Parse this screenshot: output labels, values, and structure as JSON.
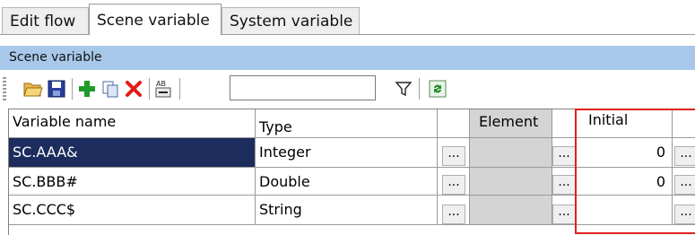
{
  "tabs": [
    {
      "label": "Edit flow"
    },
    {
      "label": "Scene variable"
    },
    {
      "label": "System variable"
    }
  ],
  "panel": {
    "title": "Scene variable"
  },
  "toolbar": {
    "search_value": "",
    "icons": [
      "open-folder-icon",
      "save-icon",
      "add-icon",
      "copy-icon",
      "delete-icon",
      "find-replace-icon",
      "filter-icon",
      "refresh-icon"
    ]
  },
  "grid": {
    "headers": {
      "name": "Variable name",
      "type": "Type",
      "element": "Element",
      "initial": "Initial"
    },
    "rows": [
      {
        "name": "SC.AAA&",
        "type": "Integer",
        "initial": "0"
      },
      {
        "name": "SC.BBB#",
        "type": "Double",
        "initial": "0"
      },
      {
        "name": "SC.CCC$",
        "type": "String",
        "initial": ""
      }
    ],
    "ellipsis": "..."
  },
  "colors": {
    "selection": "#1c2c5c",
    "panel_header": "#a8c8ea",
    "highlight_box": "#e02020"
  }
}
